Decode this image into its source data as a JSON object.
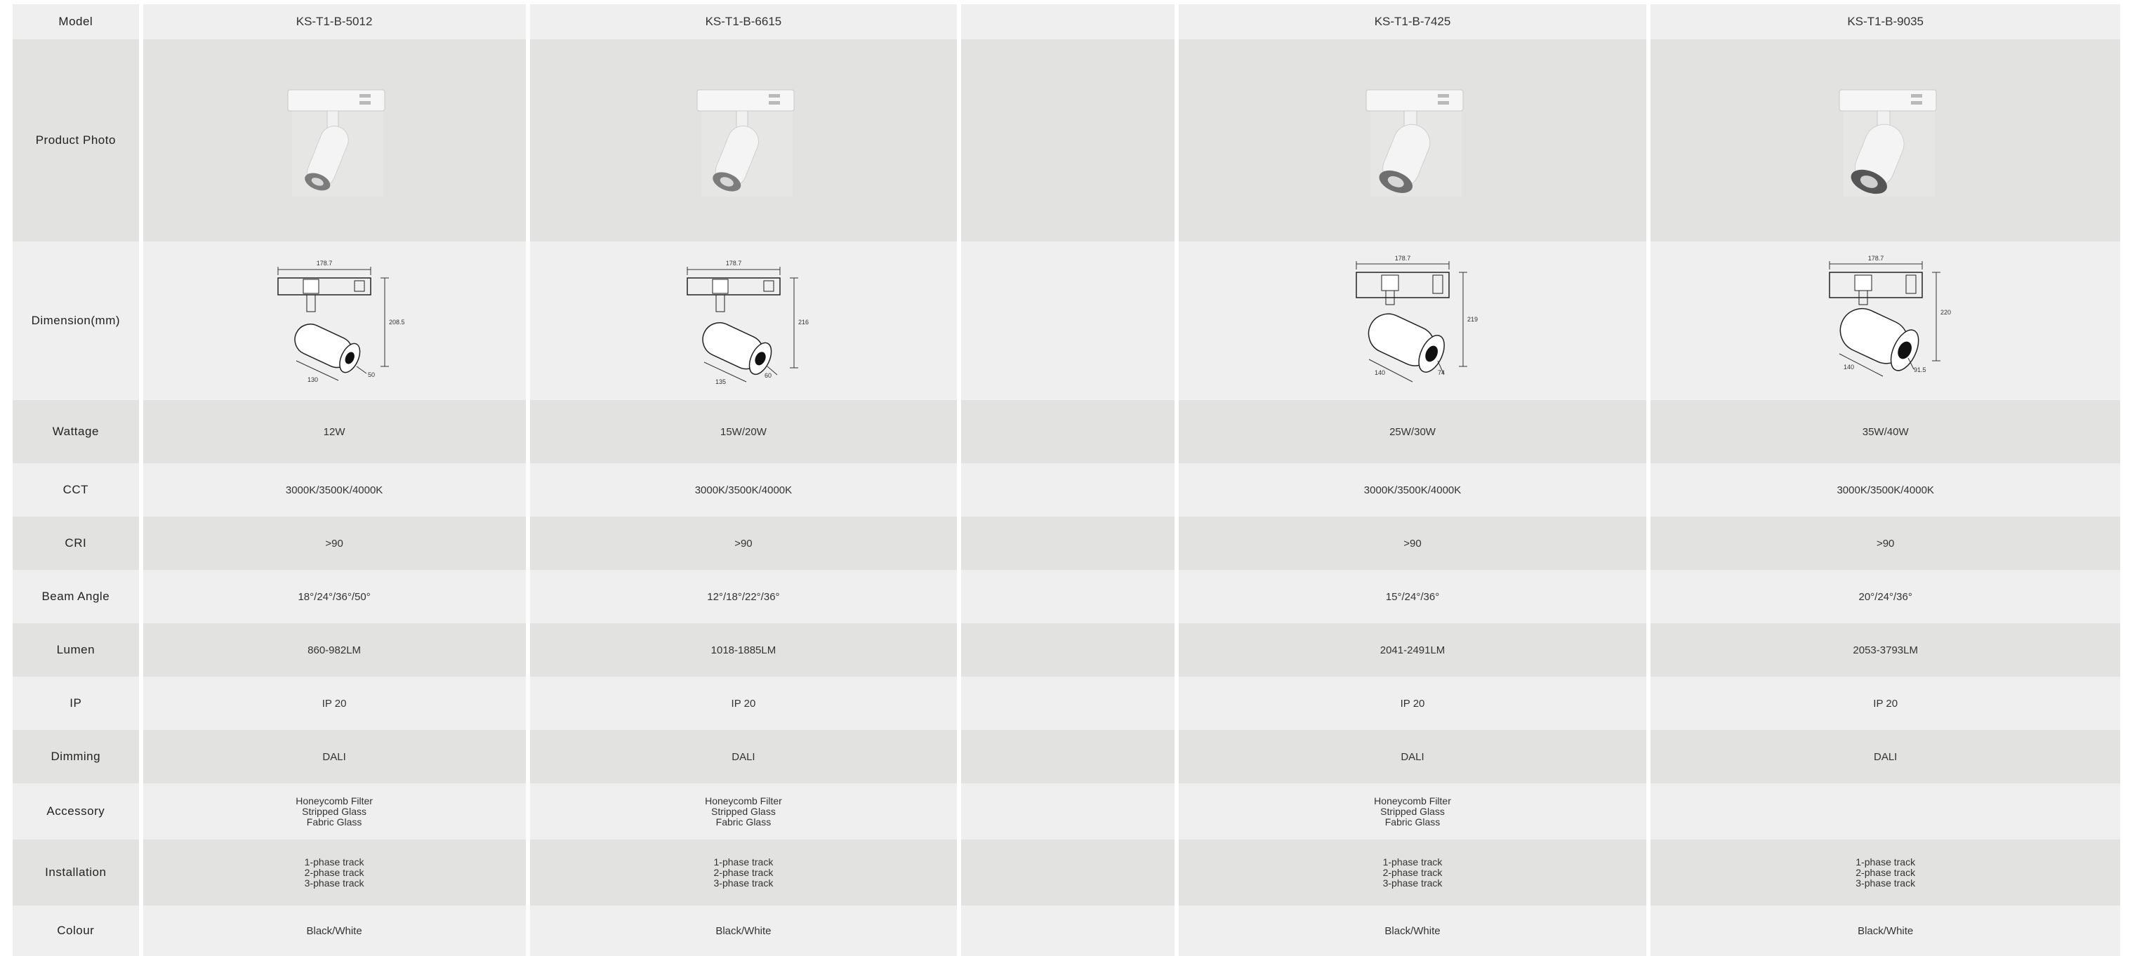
{
  "labels": {
    "model": "Model",
    "photo": "Product Photo",
    "dimension": "Dimension(mm)",
    "wattage": "Wattage",
    "cct": "CCT",
    "cri": "CRI",
    "beam_angle": "Beam Angle",
    "lumen": "Lumen",
    "ip": "IP",
    "dimming": "Dimming",
    "accessory": "Accessory",
    "installation": "Installation",
    "colour": "Colour"
  },
  "products": [
    {
      "model": "KS-T1-B-5012",
      "wattage": "12W",
      "cct": "3000K/3500K/4000K",
      "cri": ">90",
      "beam_angle": "18°/24°/36°/50°",
      "lumen": "860-982LM",
      "ip": "IP 20",
      "dimming": "DALI",
      "accessory": [
        "Honeycomb Filter",
        "Stripped Glass",
        "Fabric Glass"
      ],
      "installation": [
        "1-phase track",
        "2-phase track",
        "3-phase track"
      ],
      "colour": "Black/White",
      "dims": {
        "width": "178.7",
        "height": "208.5",
        "length": "130",
        "diameter": "50"
      }
    },
    {
      "model": "KS-T1-B-6615",
      "wattage": "15W/20W",
      "cct": "3000K/3500K/4000K",
      "cri": ">90",
      "beam_angle": "12°/18°/22°/36°",
      "lumen": "1018-1885LM",
      "ip": "IP 20",
      "dimming": "DALI",
      "accessory": [
        "Honeycomb Filter",
        "Stripped Glass",
        "Fabric Glass"
      ],
      "installation": [
        "1-phase track",
        "2-phase track",
        "3-phase track"
      ],
      "colour": "Black/White",
      "dims": {
        "width": "178.7",
        "height": "216",
        "length": "135",
        "diameter": "60"
      }
    },
    {
      "model": "",
      "wattage": "",
      "cct": "",
      "cri": "",
      "beam_angle": "",
      "lumen": "",
      "ip": "",
      "dimming": "",
      "accessory": [],
      "installation": [],
      "colour": ""
    },
    {
      "model": "KS-T1-B-7425",
      "wattage": "25W/30W",
      "cct": "3000K/3500K/4000K",
      "cri": ">90",
      "beam_angle": "15°/24°/36°",
      "lumen": "2041-2491LM",
      "ip": "IP 20",
      "dimming": "DALI",
      "accessory": [
        "Honeycomb Filter",
        "Stripped Glass",
        "Fabric Glass"
      ],
      "installation": [
        "1-phase track",
        "2-phase track",
        "3-phase track"
      ],
      "colour": "Black/White",
      "dims": {
        "width": "178.7",
        "height": "219",
        "length": "140",
        "diameter": "74"
      }
    },
    {
      "model": "KS-T1-B-9035",
      "wattage": "35W/40W",
      "cct": "3000K/3500K/4000K",
      "cri": ">90",
      "beam_angle": "20°/24°/36°",
      "lumen": "2053-3793LM",
      "ip": "IP 20",
      "dimming": "DALI",
      "accessory": [],
      "installation": [
        "1-phase track",
        "2-phase track",
        "3-phase track"
      ],
      "colour": "Black/White",
      "dims": {
        "width": "178.7",
        "height": "220",
        "length": "140",
        "diameter": "91.5"
      }
    }
  ]
}
